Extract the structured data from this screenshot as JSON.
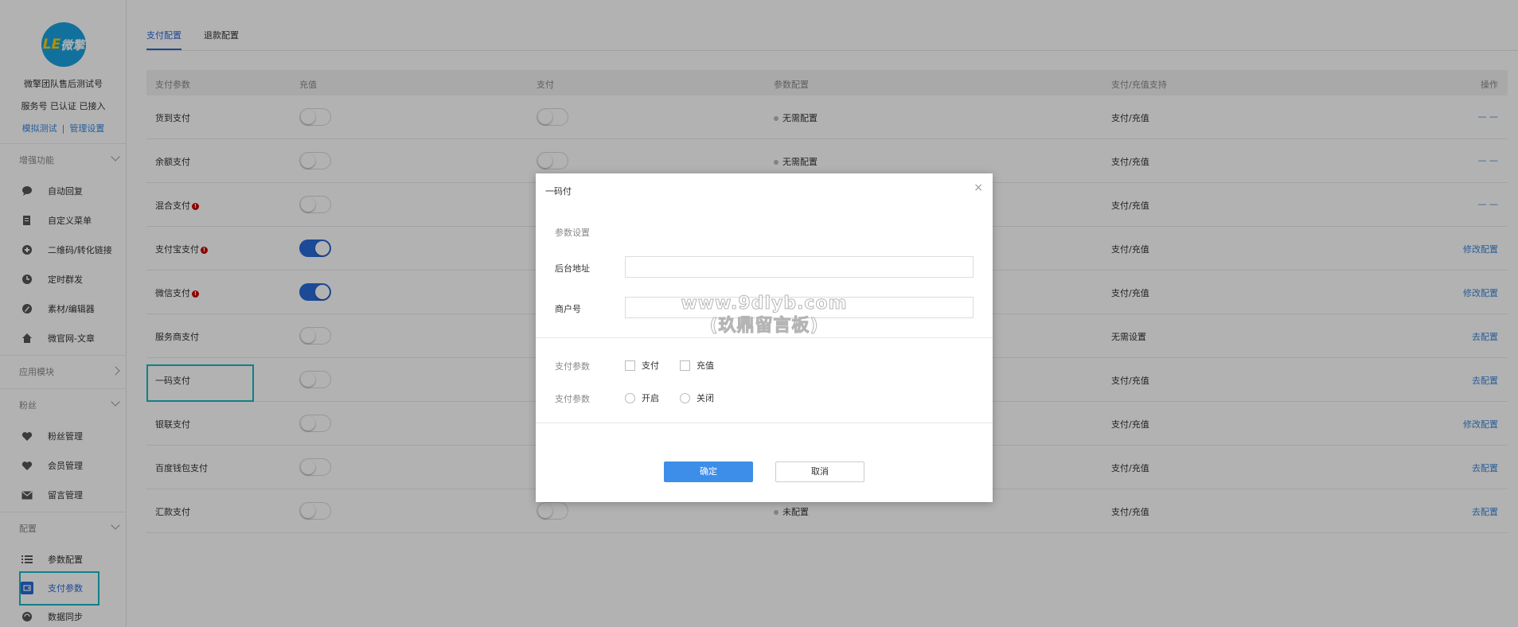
{
  "sidebar": {
    "logo_text_1": "LE",
    "logo_text_2": "微擎",
    "account_name": "微擎团队售后测试号",
    "account_status": "服务号 已认证 已接入",
    "link_test": "模拟测试",
    "link_sep": "|",
    "link_manage": "管理设置",
    "sections": [
      {
        "label": "增强功能",
        "expanded": true,
        "items": [
          {
            "label": "自动回复",
            "icon": "chat-icon"
          },
          {
            "label": "自定义菜单",
            "icon": "menu-doc-icon"
          },
          {
            "label": "二维码/转化链接",
            "icon": "qrcode-link-icon"
          },
          {
            "label": "定时群发",
            "icon": "clock-icon"
          },
          {
            "label": "素材/编辑器",
            "icon": "pen-icon"
          },
          {
            "label": "微官网-文章",
            "icon": "home-icon"
          }
        ]
      },
      {
        "label": "应用模块",
        "expanded": false,
        "items": []
      },
      {
        "label": "粉丝",
        "expanded": true,
        "items": [
          {
            "label": "粉丝管理",
            "icon": "heart-icon"
          },
          {
            "label": "会员管理",
            "icon": "heart-icon"
          },
          {
            "label": "留言管理",
            "icon": "mail-icon"
          }
        ]
      },
      {
        "label": "配置",
        "expanded": true,
        "items": [
          {
            "label": "参数配置",
            "icon": "list-icon"
          },
          {
            "label": "支付参数",
            "icon": "wallet-icon",
            "active": true
          },
          {
            "label": "数据同步",
            "icon": "sync-icon"
          }
        ]
      }
    ]
  },
  "tabs": [
    {
      "label": "支付配置",
      "active": true
    },
    {
      "label": "退款配置",
      "active": false
    }
  ],
  "table": {
    "headers": [
      "支付参数",
      "充值",
      "支付",
      "参数配置",
      "支付/充值支持",
      "操作"
    ],
    "rows": [
      {
        "name": "货到支付",
        "warn": false,
        "recharge_on": false,
        "pay_on": false,
        "config": "无需配置",
        "support": "支付/充值",
        "op": "— —"
      },
      {
        "name": "余额支付",
        "warn": false,
        "recharge_on": false,
        "pay_on": false,
        "config": "无需配置",
        "support": "支付/充值",
        "op": "— —"
      },
      {
        "name": "混合支付",
        "warn": true,
        "recharge_on": false,
        "pay_on": null,
        "config": "",
        "support": "支付/充值",
        "op": "— —"
      },
      {
        "name": "支付宝支付",
        "warn": true,
        "recharge_on": true,
        "pay_on": null,
        "config": "",
        "support": "支付/充值",
        "op": "修改配置"
      },
      {
        "name": "微信支付",
        "warn": true,
        "recharge_on": true,
        "pay_on": null,
        "config": "",
        "support": "支付/充值",
        "op": "修改配置"
      },
      {
        "name": "服务商支付",
        "warn": false,
        "recharge_on": false,
        "pay_on": null,
        "config": "",
        "support": "无需设置",
        "op": "去配置"
      },
      {
        "name": "一码支付",
        "warn": false,
        "recharge_on": false,
        "pay_on": null,
        "config": "",
        "support": "支付/充值",
        "op": "去配置"
      },
      {
        "name": "银联支付",
        "warn": false,
        "recharge_on": false,
        "pay_on": null,
        "config": "",
        "support": "支付/充值",
        "op": "修改配置"
      },
      {
        "name": "百度钱包支付",
        "warn": false,
        "recharge_on": false,
        "pay_on": null,
        "config": "",
        "support": "支付/充值",
        "op": "去配置"
      },
      {
        "name": "汇款支付",
        "warn": false,
        "recharge_on": false,
        "pay_on": false,
        "config": "未配置",
        "support": "支付/充值",
        "op": "去配置"
      }
    ]
  },
  "modal": {
    "title": "一码付",
    "close": "×",
    "section_label": "参数设置",
    "field_backend": "后台地址",
    "field_backend_value": "",
    "field_merchant": "商户号",
    "field_merchant_value": "",
    "pay_params_label_1": "支付参数",
    "opt_pay": "支付",
    "opt_recharge": "充值",
    "pay_params_label_2": "支付参数",
    "opt_on": "开启",
    "opt_off": "关闭",
    "confirm": "确定",
    "cancel": "取消"
  },
  "watermark": {
    "line1": "www.9dlyb.com",
    "line2": "(玖鼎留言板)"
  },
  "colors": {
    "accent": "#2a6ad8",
    "link": "#3b86d8",
    "highlight": "#18b8c4",
    "warn": "#cc0000"
  }
}
